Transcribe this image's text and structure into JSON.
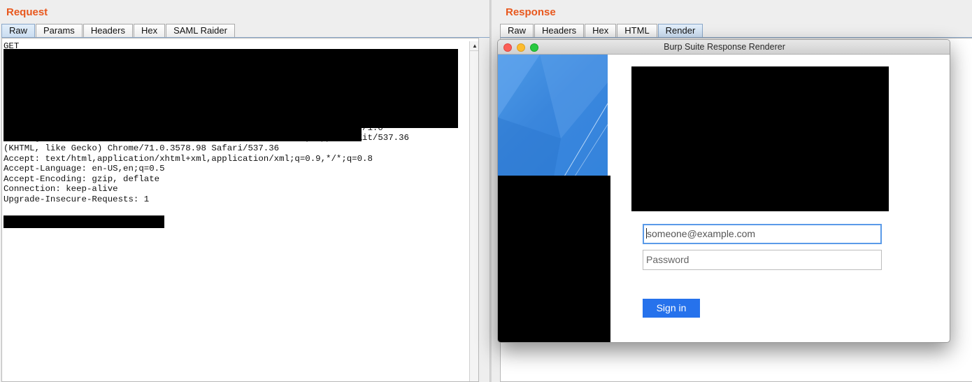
{
  "request": {
    "title": "Request",
    "tabs": [
      {
        "label": "Raw",
        "active": true
      },
      {
        "label": "Params",
        "active": false
      },
      {
        "label": "Headers",
        "active": false
      },
      {
        "label": "Hex",
        "active": false
      },
      {
        "label": "SAML Raider",
        "active": false
      }
    ],
    "raw_text": "GET\n\n\n\n\n\n\n\n                                                                 HTTP/1.0\nUser-Agent: Mozilla/5.0 (Macintosh; Intel Mac OS X 10_14_2) AppleWebKit/537.36\n(KHTML, like Gecko) Chrome/71.0.3578.98 Safari/537.36\nAccept: text/html,application/xhtml+xml,application/xml;q=0.9,*/*;q=0.8\nAccept-Language: en-US,en;q=0.5\nAccept-Encoding: gzip, deflate\nConnection: keep-alive\nUpgrade-Insecure-Requests: 1"
  },
  "response": {
    "title": "Response",
    "tabs": [
      {
        "label": "Raw",
        "active": false
      },
      {
        "label": "Headers",
        "active": false
      },
      {
        "label": "Hex",
        "active": false
      },
      {
        "label": "HTML",
        "active": false
      },
      {
        "label": "Render",
        "active": true
      }
    ]
  },
  "renderer": {
    "window_title": "Burp Suite Response Renderer",
    "email_placeholder": "someone@example.com",
    "password_placeholder": "Password",
    "signin_label": "Sign in"
  },
  "colors": {
    "section_title": "#e8581e",
    "signin_button": "#2672ec",
    "hero_blue": "#3a86dc",
    "active_tab": "#c9dcf0"
  }
}
